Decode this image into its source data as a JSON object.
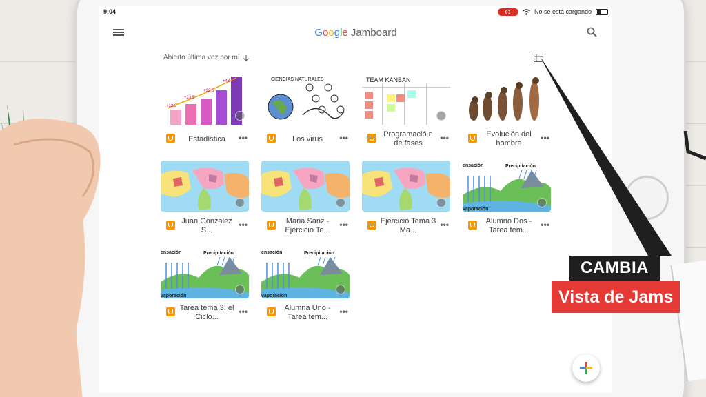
{
  "status_bar": {
    "time": "9:04",
    "charging_text": "No se está cargando"
  },
  "app": {
    "brand_google": "Google",
    "brand_product": "Jamboard",
    "sort_label": "Abierto última vez por mí"
  },
  "jams": [
    {
      "title": "Estadística",
      "thumb": "stats"
    },
    {
      "title": "Los virus",
      "thumb": "virus"
    },
    {
      "title": "Programació n de fases",
      "thumb": "kanban"
    },
    {
      "title": "Evolución del hombre",
      "thumb": "evolution"
    },
    {
      "title": "Juan Gonzalez S...",
      "thumb": "map"
    },
    {
      "title": "Maria Sanz - Ejercicio Te...",
      "thumb": "map"
    },
    {
      "title": "Ejercicio Tema 3 Ma...",
      "thumb": "map"
    },
    {
      "title": "Alumno Dos - Tarea tem...",
      "thumb": "water"
    },
    {
      "title": "Tarea tema 3: el Ciclo...",
      "thumb": "water"
    },
    {
      "title": "Alumna Uno - Tarea tem...",
      "thumb": "water"
    }
  ],
  "thumb_text": {
    "stats_values": [
      "+43.3",
      "+32.5",
      "+23.5",
      "+12.2"
    ],
    "virus_title": "CIENCIAS NATURALES",
    "kanban_title": "TEAM KANBAN",
    "water_top_left": "ensación",
    "water_top_right": "Precipitación",
    "water_bottom": "vaporación"
  },
  "callout": {
    "line1": "CAMBIA",
    "line2": "Vista de Jams"
  },
  "colors": {
    "accent_orange": "#f29900",
    "callout_red": "#e53935",
    "callout_dark": "#1f1f1f"
  }
}
